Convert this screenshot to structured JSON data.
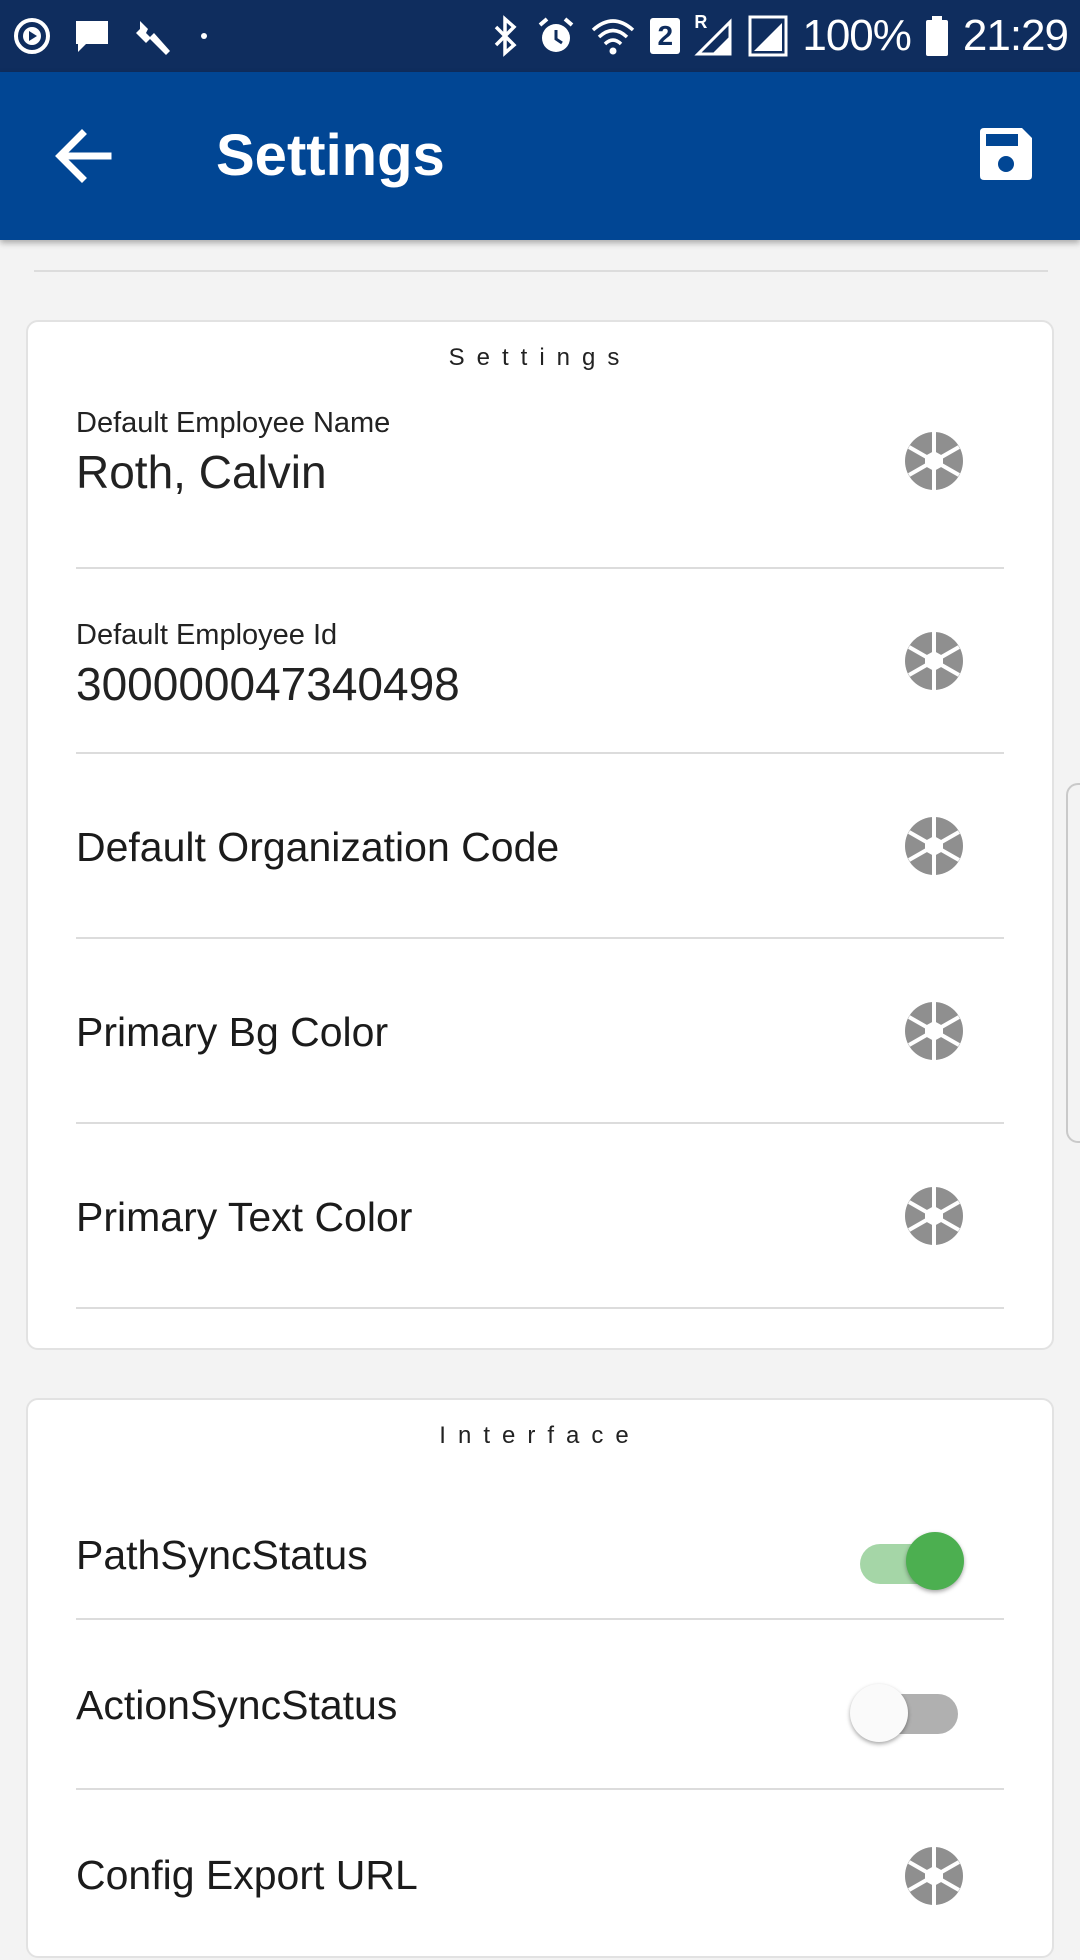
{
  "status_bar": {
    "battery": "100%",
    "time": "21:29",
    "sim_badge": "2",
    "roaming": "R",
    "icons": [
      "cast-icon",
      "message-icon",
      "wrench-icon",
      "dot-icon",
      "bluetooth-icon",
      "alarm-icon",
      "wifi-icon",
      "signal-icon",
      "battery-icon"
    ]
  },
  "app_bar": {
    "title": "Settings",
    "back_icon": "arrow-left-icon",
    "save_icon": "floppy-disk-icon",
    "color": "#014694"
  },
  "settings_card": {
    "title": "Settings",
    "rows": [
      {
        "label": "Default Employee Name",
        "value": "Roth, Calvin"
      },
      {
        "label": "Default Employee Id",
        "value": "300000047340498"
      },
      {
        "label": "Default Organization Code"
      },
      {
        "label": "Primary Bg Color"
      },
      {
        "label": "Primary Text Color"
      }
    ]
  },
  "interface_card": {
    "title": "Interface",
    "rows": [
      {
        "label": "PathSyncStatus",
        "toggle_on": true
      },
      {
        "label": "ActionSyncStatus",
        "toggle_on": false
      },
      {
        "label": "Config Export URL"
      }
    ]
  },
  "colors": {
    "status_bar": "#0f2d5e",
    "toggle_on_thumb": "#4caf50",
    "toggle_on_track": "#a5d6a7",
    "toggle_off_thumb": "#fafafa",
    "toggle_off_track": "#b0b0b0",
    "icon_gray": "#8f8f8f"
  }
}
